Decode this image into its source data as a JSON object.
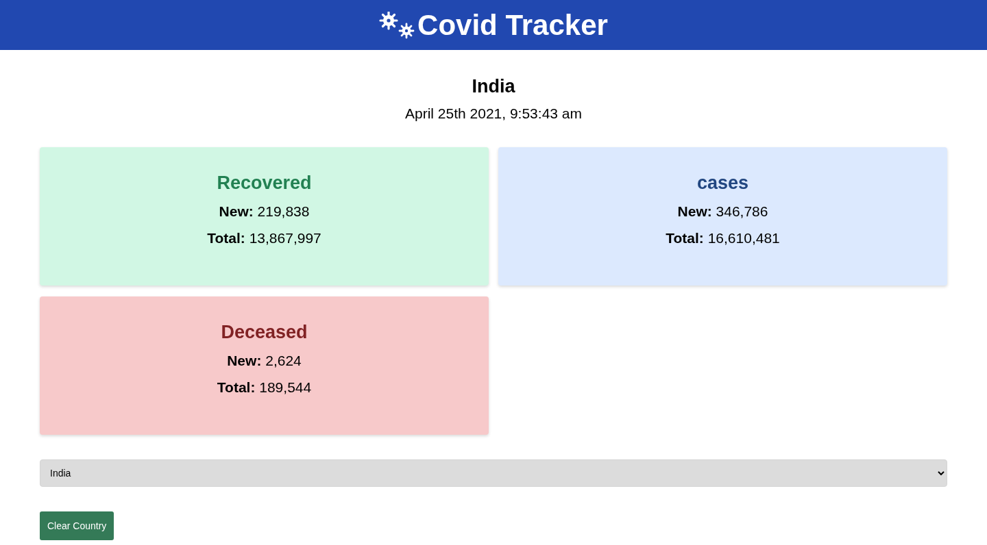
{
  "header": {
    "title": "Covid Tracker"
  },
  "country": {
    "name": "India",
    "updated": "April 25th 2021, 9:53:43 am"
  },
  "cards": [
    {
      "title": "Recovered",
      "color": "#d1f7e4",
      "lines": [
        "**New:** 219,838",
        "**Total:** 13,867,997"
      ]
    },
    {
      "title": "cases",
      "color": "#dce9fe",
      "lines": [
        "**New:** 346,786",
        "**Total:** 16,610,481"
      ]
    },
    {
      "title": "Deceased",
      "color": "#f7c9ca",
      "lines": [
        "**New:** 2,624",
        "**Total:** 189,544"
      ]
    }
  ],
  "country_select": {
    "value": "India"
  },
  "buttons": [
    "Clear Country"
  ]
}
